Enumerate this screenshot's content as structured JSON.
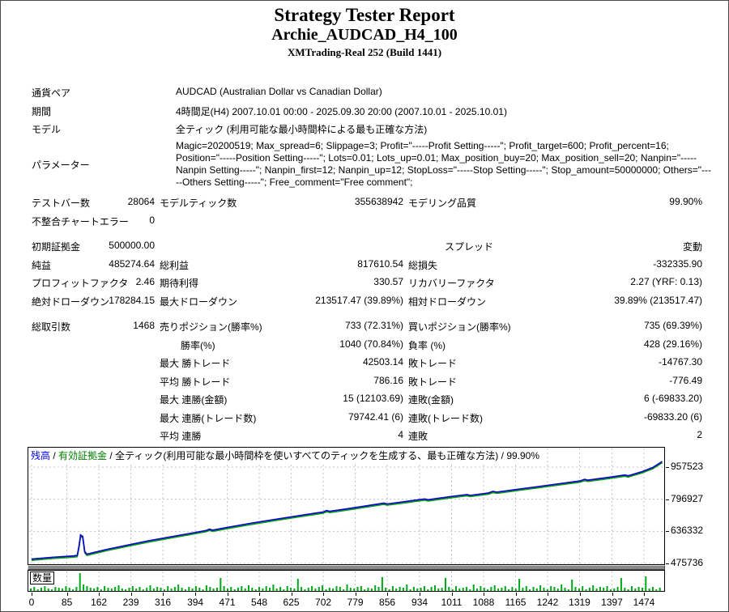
{
  "header": {
    "title": "Strategy Tester Report",
    "symbol_name": "Archie_AUDCAD_H4_100",
    "server": "XMTrading-Real 252 (Build 1441)"
  },
  "info": {
    "rows": [
      {
        "label": "通貨ペア",
        "value": "AUDCAD (Australian Dollar vs Canadian Dollar)"
      },
      {
        "label": "期間",
        "value": "4時間足(H4) 2007.10.01 00:00 - 2025.09.30 20:00 (2007.10.01 - 2025.10.01)"
      },
      {
        "label": "モデル",
        "value": "全ティック (利用可能な最小時間枠による最も正確な方法)"
      },
      {
        "label": "パラメーター",
        "value": "Magic=20200519; Max_spread=6; Slippage=3; Profit=\"-----Profit Setting-----\"; Profit_target=600; Profit_percent=16; Position=\"-----Position Setting-----\"; Lots=0.01; Lots_up=0.01; Max_position_buy=20; Max_position_sell=20; Nanpin=\"-----Nanpin Setting-----\"; Nanpin_first=12; Nanpin_up=12; StopLoss=\"-----Stop Setting-----\"; Stop_amount=50000000; Others=\"-----Others Setting-----\"; Free_comment=\"Free comment\";"
      }
    ]
  },
  "stats": {
    "rows": [
      {
        "c1l": "テストバー数",
        "c1v": "28064",
        "c2l": "モデルティック数",
        "c2v": "355638942",
        "c3l": "モデリング品質",
        "c3v": "99.90%"
      },
      {
        "c1l": "不整合チャートエラー",
        "c1v": "0"
      },
      {
        "c1l": "初期証拠金",
        "c1v": "500000.00",
        "c3l": "スプレッド",
        "c3v": "変動",
        "pad3": true
      },
      {
        "c1l": "純益",
        "c1v": "485274.64",
        "c2l": "総利益",
        "c2v": "817610.54",
        "c3l": "総損失",
        "c3v": "-332335.90"
      },
      {
        "c1l": "プロフィットファクタ",
        "c1v": "2.46",
        "c2l": "期待利得",
        "c2v": "330.57",
        "c3l": "リカバリーファクタ",
        "c3v": "2.27 (YRF: 0.13)"
      },
      {
        "c1l": "絶対ドローダウン",
        "c1v": "178284.15",
        "c2l": "最大ドローダウン",
        "c2v": "213517.47 (39.89%)",
        "c3l": "相対ドローダウン",
        "c3v": "39.89% (213517.47)"
      },
      {
        "c1l": "総取引数",
        "c1v": "1468",
        "c2l": "売りポジション(勝率%)",
        "c2v": "733 (72.31%)",
        "c3l": "買いポジション(勝率%)",
        "c3v": "735 (69.39%)"
      },
      {
        "c2l": "勝率(%)",
        "c2v": "1040 (70.84%)",
        "c3l": "負率 (%)",
        "c3v": "428 (29.16%)",
        "ind2": true
      },
      {
        "c2l": "最大 勝トレード",
        "c2v": "42503.14",
        "c3l": "敗トレード",
        "c3v": "-14767.30"
      },
      {
        "c2l": "平均 勝トレード",
        "c2v": "786.16",
        "c3l": "敗トレード",
        "c3v": "-776.49"
      },
      {
        "c2l": "最大 連勝(金額)",
        "c2v": "15 (12103.69)",
        "c3l": "連敗(金額)",
        "c3v": "6 (-69833.20)"
      },
      {
        "c2l": "最大 連勝(トレード数)",
        "c2v": "79742.41 (6)",
        "c3l": "連敗(トレード数)",
        "c3v": "-69833.20 (6)"
      },
      {
        "c2l": "平均 連勝",
        "c2v": "4",
        "c3l": "連敗",
        "c3v": "2"
      }
    ]
  },
  "chart_data": {
    "type": "line",
    "legend": [
      {
        "label": "残高",
        "color": "#0000E0"
      },
      {
        "label": "有効証拠金",
        "color": "#008000"
      }
    ],
    "separator": " / ",
    "model_desc": "全ティック(利用可能な最小時間枠を使いすべてのティックを生成する、最も正確な方法)",
    "quality": "99.90%",
    "volume_title": "数量",
    "x_ticks": [
      0,
      85,
      162,
      239,
      316,
      394,
      471,
      548,
      625,
      702,
      779,
      856,
      934,
      1011,
      1088,
      1165,
      1242,
      1319,
      1397,
      1474
    ],
    "y_ticks": [
      957523,
      796927,
      636332,
      475736
    ],
    "x_max": 1530,
    "y_axis_bottom_value": 475736,
    "y_axis_top_value": 957523,
    "grid": true,
    "colors": {
      "balance_line": "#0C0CC0",
      "equity_line": "#00A000",
      "volume_bar": "#00A818",
      "gridline": "#C3C3C3"
    },
    "balance_series": [
      [
        0,
        497000
      ],
      [
        50,
        506000
      ],
      [
        100,
        513000
      ],
      [
        110,
        516000
      ],
      [
        114,
        560000
      ],
      [
        118,
        618000
      ],
      [
        123,
        610000
      ],
      [
        128,
        535000
      ],
      [
        133,
        522000
      ],
      [
        180,
        545000
      ],
      [
        230,
        567000
      ],
      [
        280,
        588000
      ],
      [
        330,
        607000
      ],
      [
        380,
        625000
      ],
      [
        420,
        640000
      ],
      [
        428,
        647000
      ],
      [
        436,
        642000
      ],
      [
        480,
        659000
      ],
      [
        530,
        677000
      ],
      [
        580,
        694000
      ],
      [
        630,
        710000
      ],
      [
        680,
        726000
      ],
      [
        702,
        733000
      ],
      [
        710,
        740000
      ],
      [
        718,
        736000
      ],
      [
        770,
        752000
      ],
      [
        820,
        768000
      ],
      [
        848,
        777000
      ],
      [
        856,
        773000
      ],
      [
        910,
        788000
      ],
      [
        946,
        798000
      ],
      [
        954,
        794000
      ],
      [
        1010,
        810000
      ],
      [
        1048,
        820000
      ],
      [
        1056,
        816000
      ],
      [
        1100,
        828000
      ],
      [
        1110,
        836000
      ],
      [
        1120,
        832000
      ],
      [
        1170,
        846000
      ],
      [
        1220,
        860000
      ],
      [
        1270,
        874000
      ],
      [
        1320,
        888000
      ],
      [
        1331,
        896000
      ],
      [
        1339,
        892000
      ],
      [
        1390,
        906000
      ],
      [
        1428,
        918000
      ],
      [
        1436,
        914000
      ],
      [
        1470,
        935000
      ],
      [
        1495,
        955000
      ],
      [
        1518,
        985274
      ]
    ],
    "volume_bars": [
      3,
      5,
      2,
      4,
      6,
      3,
      2,
      5,
      4,
      3,
      6,
      4,
      2,
      5,
      22,
      8,
      6,
      4,
      3,
      5,
      2,
      6,
      4,
      3,
      5,
      7,
      3,
      2,
      4,
      6,
      3,
      5,
      2,
      4,
      7,
      3,
      5,
      4,
      2,
      6,
      3,
      5,
      8,
      4,
      2,
      5,
      3,
      6,
      4,
      2,
      7,
      5,
      3,
      4,
      16,
      6,
      3,
      5,
      2,
      4,
      6,
      3,
      7,
      4,
      2,
      5,
      3,
      6,
      4,
      8,
      3,
      5,
      2,
      6,
      4,
      3,
      15,
      5,
      2,
      4,
      6,
      3,
      5,
      7,
      2,
      4,
      3,
      6,
      5,
      2,
      8,
      4,
      3,
      5,
      6,
      2,
      4,
      3,
      7,
      5,
      17,
      4,
      2,
      6,
      3,
      5,
      4,
      8,
      2,
      5,
      3,
      4,
      6,
      2,
      5,
      7,
      3,
      4,
      16,
      5,
      2,
      6,
      3,
      4,
      5,
      2,
      8,
      3,
      6,
      4,
      2,
      5,
      7,
      3,
      4,
      6,
      2,
      5,
      3,
      15,
      4,
      6,
      2,
      5,
      3,
      7,
      4,
      2,
      6,
      5,
      3,
      8,
      4,
      2,
      14,
      5,
      3,
      6,
      2,
      4,
      7,
      3,
      5,
      4,
      6,
      2,
      3,
      5,
      16,
      4,
      2,
      6,
      3,
      5,
      4,
      18,
      3,
      5,
      2,
      4
    ]
  }
}
